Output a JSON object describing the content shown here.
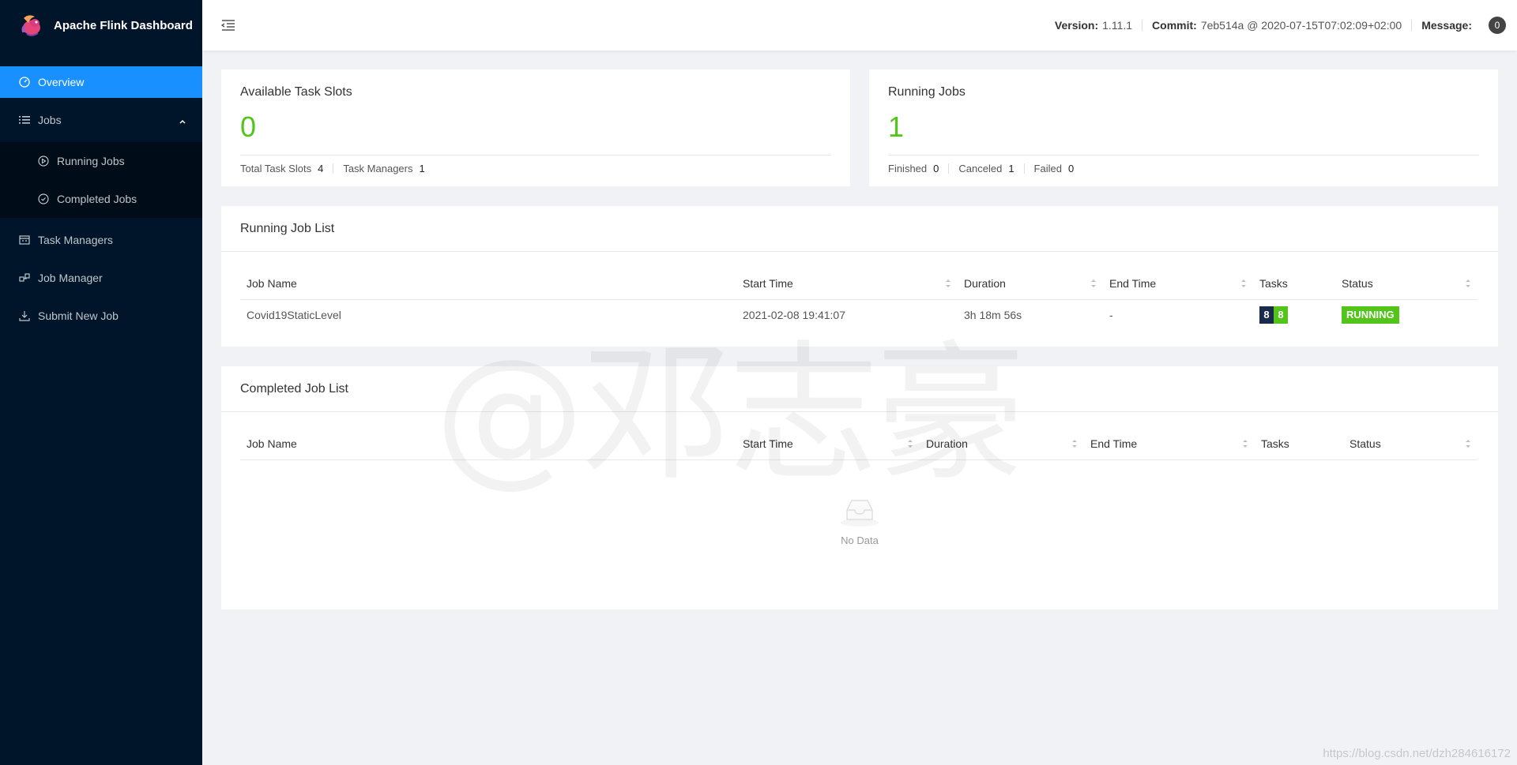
{
  "app": {
    "title": "Apache Flink Dashboard"
  },
  "sidebar": {
    "items": [
      {
        "label": "Overview"
      },
      {
        "label": "Jobs"
      },
      {
        "label": "Running Jobs"
      },
      {
        "label": "Completed Jobs"
      },
      {
        "label": "Task Managers"
      },
      {
        "label": "Job Manager"
      },
      {
        "label": "Submit New Job"
      }
    ]
  },
  "header": {
    "version_label": "Version:",
    "version_value": "1.11.1",
    "commit_label": "Commit:",
    "commit_value": "7eb514a @ 2020-07-15T07:02:09+02:00",
    "message_label": "Message:",
    "message_count": "0"
  },
  "task_slots": {
    "title": "Available Task Slots",
    "value": "0",
    "total_label": "Total Task Slots",
    "total_value": "4",
    "tm_label": "Task Managers",
    "tm_value": "1"
  },
  "running_jobs": {
    "title": "Running Jobs",
    "value": "1",
    "finished_label": "Finished",
    "finished_value": "0",
    "canceled_label": "Canceled",
    "canceled_value": "1",
    "failed_label": "Failed",
    "failed_value": "0"
  },
  "running_list": {
    "title": "Running Job List",
    "columns": [
      "Job Name",
      "Start Time",
      "Duration",
      "End Time",
      "Tasks",
      "Status"
    ],
    "rows": [
      {
        "name": "Covid19StaticLevel",
        "start": "2021-02-08 19:41:07",
        "duration": "3h 18m 56s",
        "end": "-",
        "tasks_a": "8",
        "tasks_b": "8",
        "status": "RUNNING"
      }
    ]
  },
  "completed_list": {
    "title": "Completed Job List",
    "columns": [
      "Job Name",
      "Start Time",
      "Duration",
      "End Time",
      "Tasks",
      "Status"
    ],
    "empty_text": "No Data"
  },
  "watermark": {
    "text": "@邓志豪",
    "url": "https://blog.csdn.net/dzh284616172"
  },
  "colors": {
    "sidebar": "#001529",
    "accent": "#1890ff",
    "success": "#52c41a",
    "dark_badge": "#1a2a4a"
  }
}
